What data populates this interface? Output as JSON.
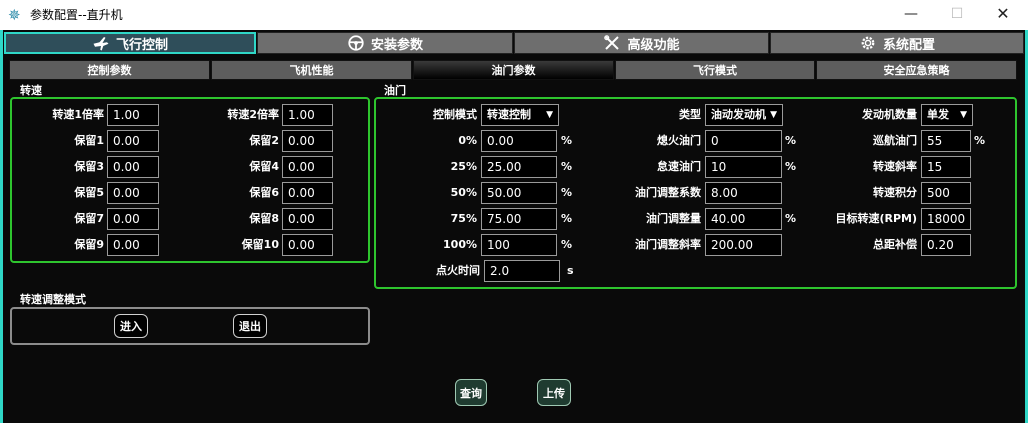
{
  "window": {
    "title": "参数配置--直升机",
    "min_glyph": "—",
    "max_glyph": "☐",
    "close_glyph": "✕"
  },
  "main_tabs": [
    {
      "label": "飞行控制",
      "icon": "plane-icon"
    },
    {
      "label": "安装参数",
      "icon": "steering-wheel-icon"
    },
    {
      "label": "高级功能",
      "icon": "tools-icon"
    },
    {
      "label": "系统配置",
      "icon": "gear-icon"
    }
  ],
  "sub_tabs": [
    "控制参数",
    "飞机性能",
    "油门参数",
    "飞行模式",
    "安全应急策略"
  ],
  "speed": {
    "title": "转速",
    "rows": [
      {
        "l1": "转速1倍率",
        "v1": "1.00",
        "l2": "转速2倍率",
        "v2": "1.00"
      },
      {
        "l1": "保留1",
        "v1": "0.00",
        "l2": "保留2",
        "v2": "0.00"
      },
      {
        "l1": "保留3",
        "v1": "0.00",
        "l2": "保留4",
        "v2": "0.00"
      },
      {
        "l1": "保留5",
        "v1": "0.00",
        "l2": "保留6",
        "v2": "0.00"
      },
      {
        "l1": "保留7",
        "v1": "0.00",
        "l2": "保留8",
        "v2": "0.00"
      },
      {
        "l1": "保留9",
        "v1": "0.00",
        "l2": "保留10",
        "v2": "0.00"
      }
    ]
  },
  "throttle": {
    "title": "油门",
    "col1": [
      {
        "label": "控制模式",
        "value": "转速控制",
        "unit": ""
      },
      {
        "label": "0%",
        "value": "0.00",
        "unit": "%"
      },
      {
        "label": "25%",
        "value": "25.00",
        "unit": "%"
      },
      {
        "label": "50%",
        "value": "50.00",
        "unit": "%"
      },
      {
        "label": "75%",
        "value": "75.00",
        "unit": "%"
      },
      {
        "label": "100%",
        "value": "100",
        "unit": "%"
      },
      {
        "label": "点火时间",
        "value": "2.0",
        "unit": "s"
      }
    ],
    "col2": [
      {
        "label": "类型",
        "value": "油动发动机",
        "unit": ""
      },
      {
        "label": "熄火油门",
        "value": "0",
        "unit": "%"
      },
      {
        "label": "怠速油门",
        "value": "10",
        "unit": "%"
      },
      {
        "label": "油门调整系数",
        "value": "8.00",
        "unit": ""
      },
      {
        "label": "油门调整量",
        "value": "40.00",
        "unit": "%"
      },
      {
        "label": "油门调整斜率",
        "value": "200.00",
        "unit": ""
      }
    ],
    "col3": [
      {
        "label": "发动机数量",
        "value": "单发",
        "unit": ""
      },
      {
        "label": "巡航油门",
        "value": "55",
        "unit": "%"
      },
      {
        "label": "转速斜率",
        "value": "15",
        "unit": ""
      },
      {
        "label": "转速积分",
        "value": "500",
        "unit": ""
      },
      {
        "label": "目标转速(RPM)",
        "value": "18000",
        "unit": ""
      },
      {
        "label": "总距补偿",
        "value": "0.20",
        "unit": ""
      }
    ]
  },
  "speed_adjust": {
    "title": "转速调整模式",
    "enter": "进入",
    "exit": "退出"
  },
  "actions": {
    "query": "查询",
    "upload": "上传"
  },
  "colors": {
    "accent": "#2fd7c7",
    "group_border": "#2ec52e"
  }
}
